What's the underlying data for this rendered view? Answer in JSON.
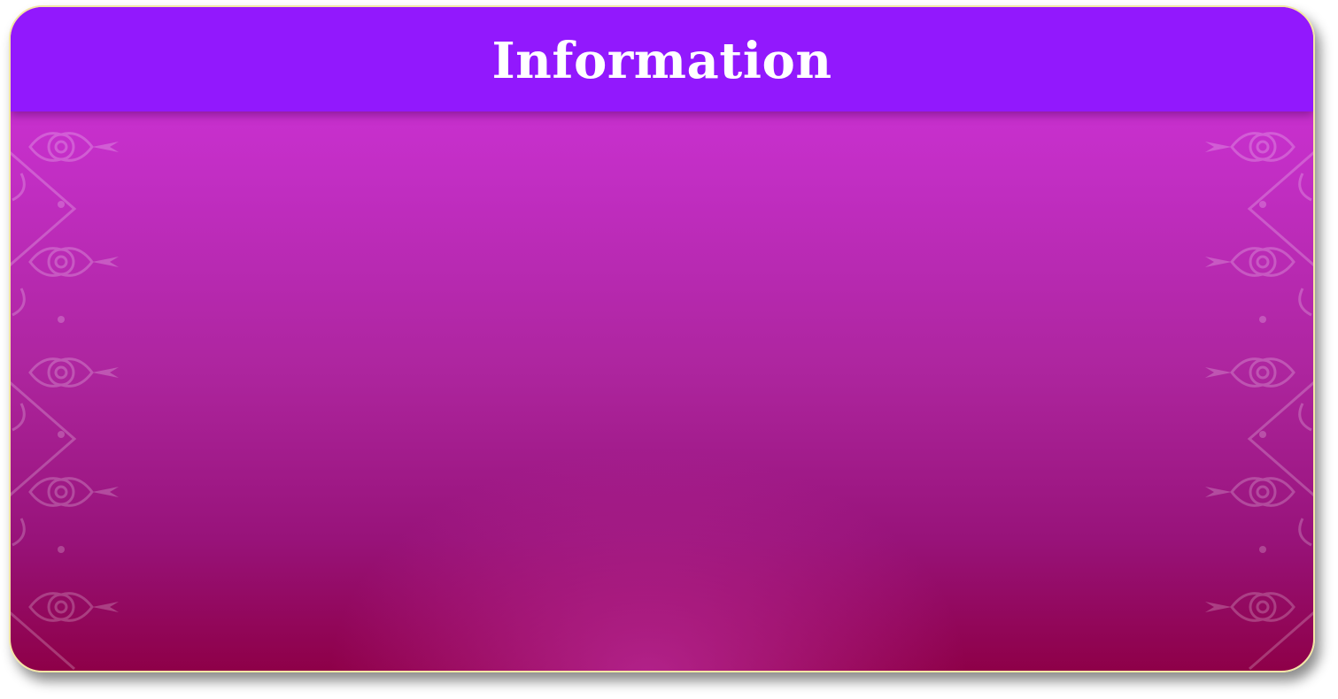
{
  "dialog": {
    "title": "Information"
  },
  "icons": {
    "left_border": "ornament-pattern-icon",
    "right_border": "ornament-pattern-icon"
  },
  "colors": {
    "header": "#9218fd",
    "body_top": "#d233e0",
    "body_bottom": "#8e0048",
    "border": "#f3e6a6",
    "title_text": "#ffffff"
  }
}
